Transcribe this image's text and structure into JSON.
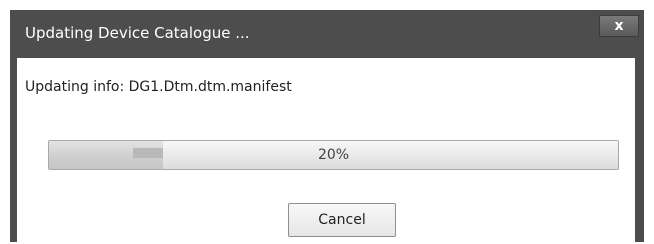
{
  "dialog": {
    "title": "Updating Device Catalogue ...",
    "close_label": "x",
    "info_text": "Updating info: DG1.Dtm.dtm.manifest",
    "progress": {
      "percent": 20,
      "label": "20%"
    },
    "cancel_label": "Cancel"
  },
  "colors": {
    "titlebar": "#4d4d4d",
    "content_bg": "#ffffff",
    "title_text": "#ffffff"
  },
  "icons": {
    "close": "close-icon"
  }
}
